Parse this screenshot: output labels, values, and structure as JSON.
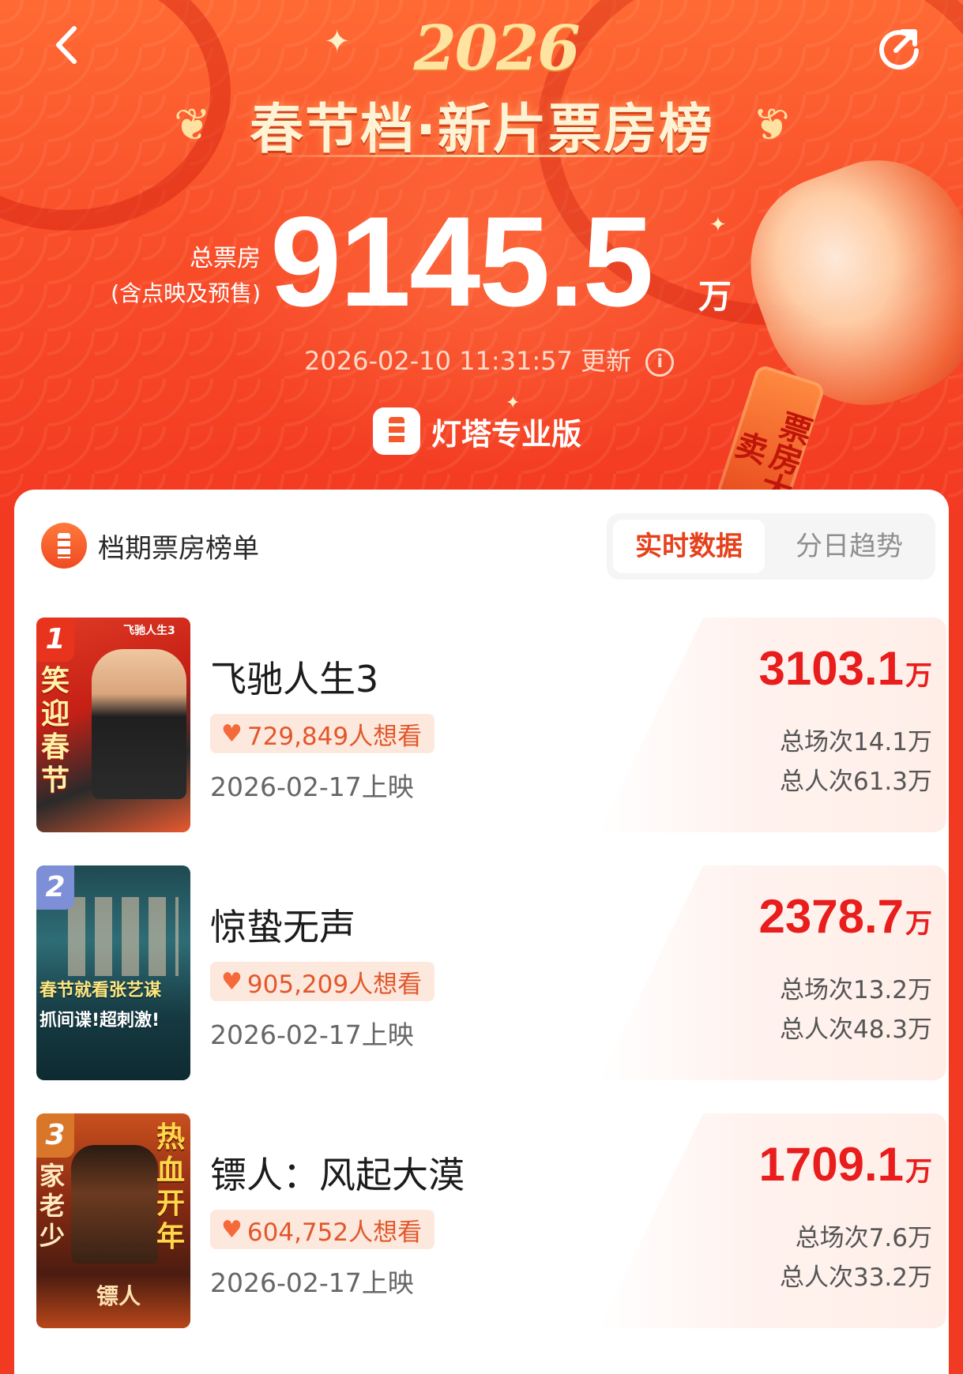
{
  "header": {
    "year": "2026",
    "title": "春节档·新片票房榜",
    "total_label_line1": "总票房",
    "total_label_line2": "(含点映及预售)",
    "total_value": "9145.5",
    "total_unit": "万",
    "update_text": "2026-02-10 11:31:57 更新",
    "info_icon": "i",
    "brand_name": "灯塔专业版",
    "lantern_tag": "票房大卖"
  },
  "section": {
    "title": "档期票房榜单",
    "tabs": [
      {
        "label": "实时数据",
        "active": true
      },
      {
        "label": "分日趋势",
        "active": false
      }
    ]
  },
  "movies": [
    {
      "rank": "1",
      "title": "飞驰人生3",
      "want_count": "729,849人想看",
      "release": "2026-02-17上映",
      "box_office": "3103.1",
      "box_unit": "万",
      "sessions": "总场次14.1万",
      "audience": "总人次61.3万",
      "poster_text": "笑迎春节",
      "poster_logo": "飞驰人生3"
    },
    {
      "rank": "2",
      "title": "惊蛰无声",
      "want_count": "905,209人想看",
      "release": "2026-02-17上映",
      "box_office": "2378.7",
      "box_unit": "万",
      "sessions": "总场次13.2万",
      "audience": "总人次48.3万",
      "poster_text_line1": "春节就看张艺谋",
      "poster_text_line2": "抓间谍!超刺激!"
    },
    {
      "rank": "3",
      "title": "镖人：风起大漠",
      "want_count": "604,752人想看",
      "release": "2026-02-17上映",
      "box_office": "1709.1",
      "box_unit": "万",
      "sessions": "总场次7.6万",
      "audience": "总人次33.2万",
      "poster_text_left": "家老少",
      "poster_text_right": "热血开年",
      "poster_logo": "镖人"
    }
  ],
  "colors": {
    "header_bg": "#f94f2a",
    "accent": "#e6411c",
    "box_office_red": "#e81d1c",
    "want_badge_bg": "#fde8de"
  },
  "icons": {
    "back": "chevron-left-icon",
    "share": "share-icon",
    "heart": "heart-icon",
    "brand": "lighthouse-icon"
  }
}
